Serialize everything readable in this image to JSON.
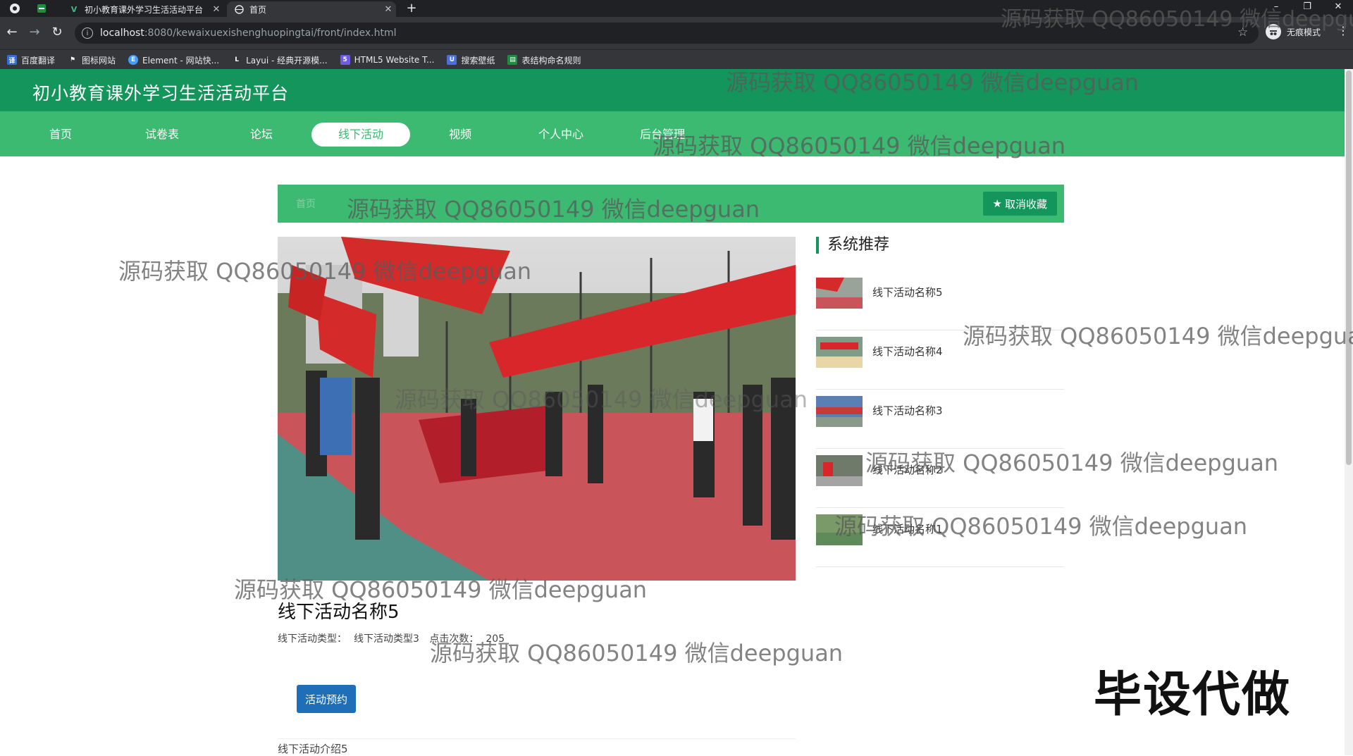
{
  "browser": {
    "tabs": [
      {
        "title": "初小教育课外学习生活活动平台",
        "active": false
      },
      {
        "title": "首页",
        "active": true
      }
    ],
    "url_host": "localhost",
    "url_rest": ":8080/kewaixuexishenghuopingtai/front/index.html",
    "profile_label": "无痕模式",
    "bookmarks": [
      "百度翻译",
      "图标网站",
      "Element - 网站快...",
      "Layui - 经典开源模...",
      "HTML5 Website T...",
      "搜索壁纸",
      "表结构命名规则"
    ]
  },
  "site": {
    "title": "初小教育课外学习生活活动平台",
    "nav": [
      "首页",
      "试卷表",
      "论坛",
      "线下活动",
      "视频",
      "个人中心",
      "后台管理"
    ],
    "active_nav": "线下活动"
  },
  "crumb": {
    "text": "首页"
  },
  "favorite_button": "取消收藏",
  "detail": {
    "title": "线下活动名称5",
    "type_label": "线下活动类型：",
    "type_value": "线下活动类型3",
    "clicks_label": "点击次数：",
    "clicks_value": "205",
    "book_button": "活动预约",
    "intro": "线下活动介绍5"
  },
  "recommend": {
    "title": "系统推荐",
    "items": [
      "线下活动名称5",
      "线下活动名称4",
      "线下活动名称3",
      "线下活动名称2",
      "线下活动名称1"
    ]
  },
  "watermark_text": "源码获取 QQ86050149 微信deepguan",
  "stamp_text": "毕设代做",
  "colors": {
    "header": "#14955c",
    "nav": "#3cba72",
    "button_blue": "#1f6fb8"
  }
}
